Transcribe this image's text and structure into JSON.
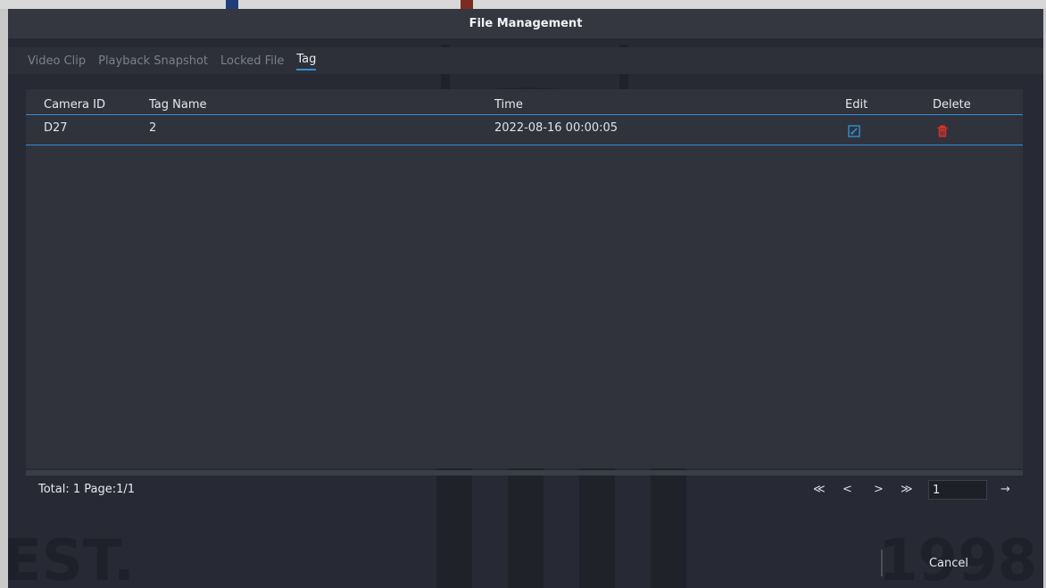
{
  "window": {
    "title": "File Management"
  },
  "tabs": [
    {
      "label": "Video Clip",
      "active": false
    },
    {
      "label": "Playback Snapshot",
      "active": false
    },
    {
      "label": "Locked File",
      "active": false
    },
    {
      "label": "Tag",
      "active": true
    }
  ],
  "table": {
    "headers": {
      "camera_id": "Camera ID",
      "tag_name": "Tag Name",
      "time": "Time",
      "edit": "Edit",
      "delete": "Delete"
    },
    "rows": [
      {
        "camera_id": "D27",
        "tag_name": "2",
        "time": "2022-08-16 00:00:05",
        "edit_icon": "edit-icon",
        "delete_icon": "trash-icon"
      }
    ]
  },
  "footer": {
    "total": "Total: 1  Page:1/1",
    "pager": {
      "first": "≪",
      "prev": "<",
      "next": ">",
      "last": "≫",
      "page_value": "1",
      "go": "→"
    },
    "cancel_label": "Cancel"
  },
  "watermark": {
    "est": "EST.",
    "year": "1998"
  },
  "colors": {
    "accent": "#2f8fd6",
    "delete": "#d9302b",
    "background": "#272a34"
  }
}
